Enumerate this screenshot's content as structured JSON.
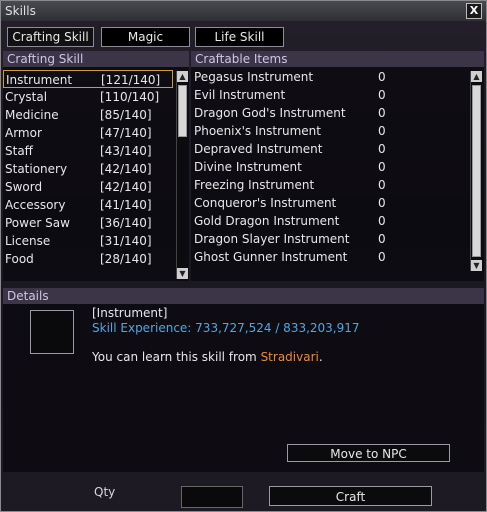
{
  "window": {
    "title": "Skills",
    "close_symbol": "X"
  },
  "tabs": [
    {
      "label": "Crafting Skill"
    },
    {
      "label": "Magic"
    },
    {
      "label": "Life Skill"
    }
  ],
  "crafting_skill": {
    "header": "Crafting Skill",
    "items": [
      {
        "name": "Instrument",
        "value": "[121/140]"
      },
      {
        "name": "Crystal",
        "value": "[110/140]"
      },
      {
        "name": "Medicine",
        "value": "[85/140]"
      },
      {
        "name": "Armor",
        "value": "[47/140]"
      },
      {
        "name": "Staff",
        "value": "[43/140]"
      },
      {
        "name": "Stationery",
        "value": "[42/140]"
      },
      {
        "name": "Sword",
        "value": "[42/140]"
      },
      {
        "name": "Accessory",
        "value": "[41/140]"
      },
      {
        "name": "Power Saw",
        "value": "[36/140]"
      },
      {
        "name": "License",
        "value": "[31/140]"
      },
      {
        "name": "Food",
        "value": "[28/140]"
      }
    ]
  },
  "craftable_items": {
    "header": "Craftable Items",
    "items": [
      {
        "name": "Pegasus Instrument",
        "count": "0"
      },
      {
        "name": "Evil Instrument",
        "count": "0"
      },
      {
        "name": "Dragon God's Instrument",
        "count": "0"
      },
      {
        "name": "Phoenix's Instrument",
        "count": "0"
      },
      {
        "name": "Depraved Instrument",
        "count": "0"
      },
      {
        "name": "Divine Instrument",
        "count": "0"
      },
      {
        "name": "Freezing Instrument",
        "count": "0"
      },
      {
        "name": "Conqueror's Instrument",
        "count": "0"
      },
      {
        "name": "Gold Dragon Instrument",
        "count": "0"
      },
      {
        "name": "Dragon Slayer Instrument",
        "count": "0"
      },
      {
        "name": "Ghost Gunner Instrument",
        "count": "0"
      }
    ]
  },
  "details": {
    "header": "Details",
    "skill_name": "[Instrument]",
    "experience_label": "Skill Experience: ",
    "experience_value": "733,727,524 / 833,203,917",
    "learn_prefix": "You can learn this skill from ",
    "npc_name": "Stradivari",
    "learn_suffix": ".",
    "move_button": "Move to NPC"
  },
  "footer": {
    "qty_label": "Qty",
    "craft_button": "Craft"
  },
  "colors": {
    "accent_blue": "#4aa8e8",
    "npc_orange": "#e88a3a",
    "header_purple": "#3b3547"
  }
}
